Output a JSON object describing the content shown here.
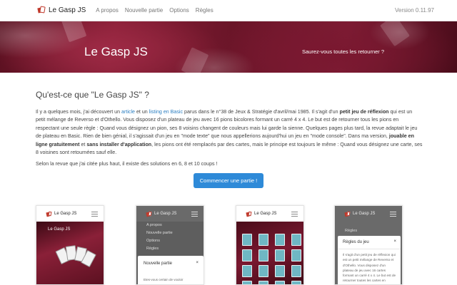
{
  "navbar": {
    "brand": "Le Gasp JS",
    "links": [
      "A propos",
      "Nouvelle partie",
      "Options",
      "Règles"
    ],
    "version": "Version 0.11.97"
  },
  "hero": {
    "title": "Le Gasp JS",
    "tagline": "Saurez-vous toutes les retourner ?"
  },
  "main": {
    "section_title": "Qu'est-ce que \"Le Gasp JS\" ?",
    "p1": {
      "s1": "Il y a quelques mois, j'ai découvert un ",
      "link_article": "article",
      "s2": " et un ",
      "link_listing": "listing en Basic",
      "s3": " parus dans le n°38 de Jeux & Stratégie d'avril/mai 1985. Il s'agit d'un ",
      "b1": "petit jeu de réflexion",
      "s4": " qui est un petit mélange de Reverso et d'Othello. Vous disposez d'un plateau de jeu avec 16 pions bicolores formant un carré 4 x 4. Le but est de retourner tous les pions en respectant une seule règle : Quand vous désignez un pion, ses 8 voisins changent de couleurs mais lui garde la sienne. Quelques pages plus tard, la revue adaptait le jeu de plateau en Basic. Rien de bien génial, il s'agissait d'un jeu en \"mode texte\" que nous appellerions aujourd'hui un jeu en \"mode console\". Dans ma version, ",
      "b2": "jouable en ligne gratuitement",
      "s5": " et ",
      "b3": "sans installer d'application",
      "s6": ", les pions ont été remplacés par des cartes, mais le principe est toujours le même : Quand vous désignez une carte, ses 8 voisines sont retournées sauf elle."
    },
    "p2": "Selon la revue que j'ai citée plus haut, il existe des solutions en 6, 8 et 10 coups !",
    "start_button": "Commencer une partie !"
  },
  "previews": {
    "brand": "Le Gasp JS",
    "p1_title": "Le Gasp JS",
    "p2_menu": [
      "A propos",
      "Nouvelle partie",
      "Options",
      "Règles"
    ],
    "p2_modal_title": "Nouvelle partie",
    "p2_modal_close": "×",
    "p2_modal_text": "Etes-vous    certain    de    vouloir",
    "p4_menu_item": "Règles",
    "p4_modal_title": "Règles du jeu",
    "p4_modal_close": "×",
    "p4_text": "Il s'agit d'un petit jeu de réflexion qui est un petit mélange de Reverso et d'Othello. Vous disposez d'un plateau de jeu avec 16 cartes formant un carré 4 x 4. Le but est de retourner toutes les cartes en respectant une seule règle : Quand vous désignez"
  },
  "icons": [
    "cards-logo-icon",
    "hamburger-menu-icon",
    "close-icon"
  ],
  "colors": {
    "accent": "#2e8ad8",
    "link": "#2a7ec1",
    "hero": "#7a1830",
    "card_back": "#6fb7c4"
  }
}
